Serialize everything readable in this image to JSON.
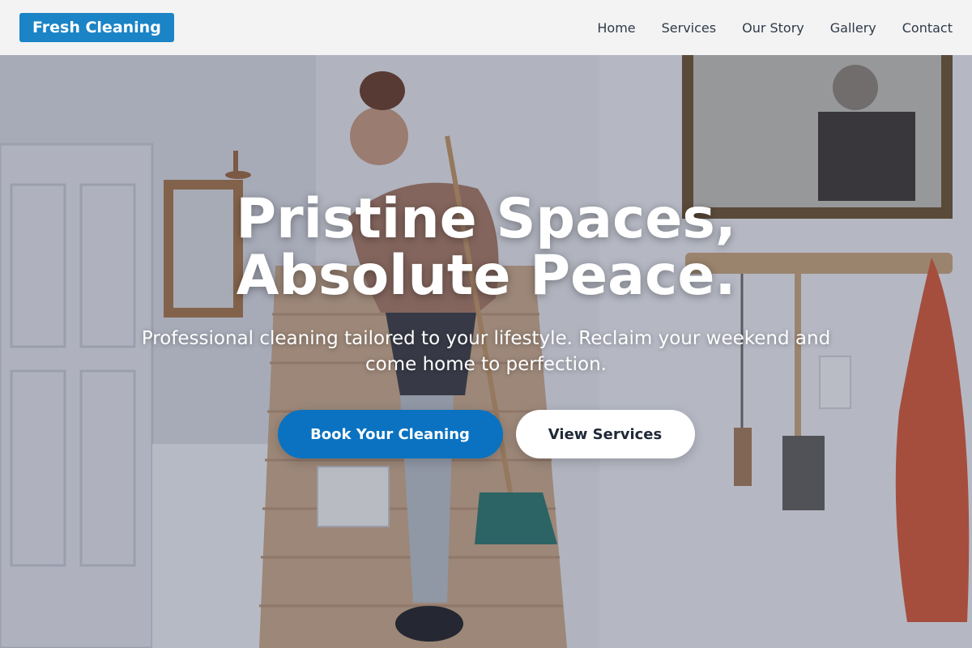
{
  "brand": {
    "logo": "Fresh Cleaning",
    "accent_color": "#1a84c6"
  },
  "nav": {
    "links": [
      {
        "label": "Home"
      },
      {
        "label": "Services"
      },
      {
        "label": "Our Story"
      },
      {
        "label": "Gallery"
      },
      {
        "label": "Contact"
      }
    ]
  },
  "hero": {
    "title_line1": "Pristine Spaces,",
    "title_line2": "Absolute Peace.",
    "subtitle": "Professional cleaning tailored to your lifestyle. Reclaim your weekend and come home to perfection.",
    "primary_cta": "Book Your Cleaning",
    "secondary_cta": "View Services",
    "primary_color": "#0a72c0"
  }
}
